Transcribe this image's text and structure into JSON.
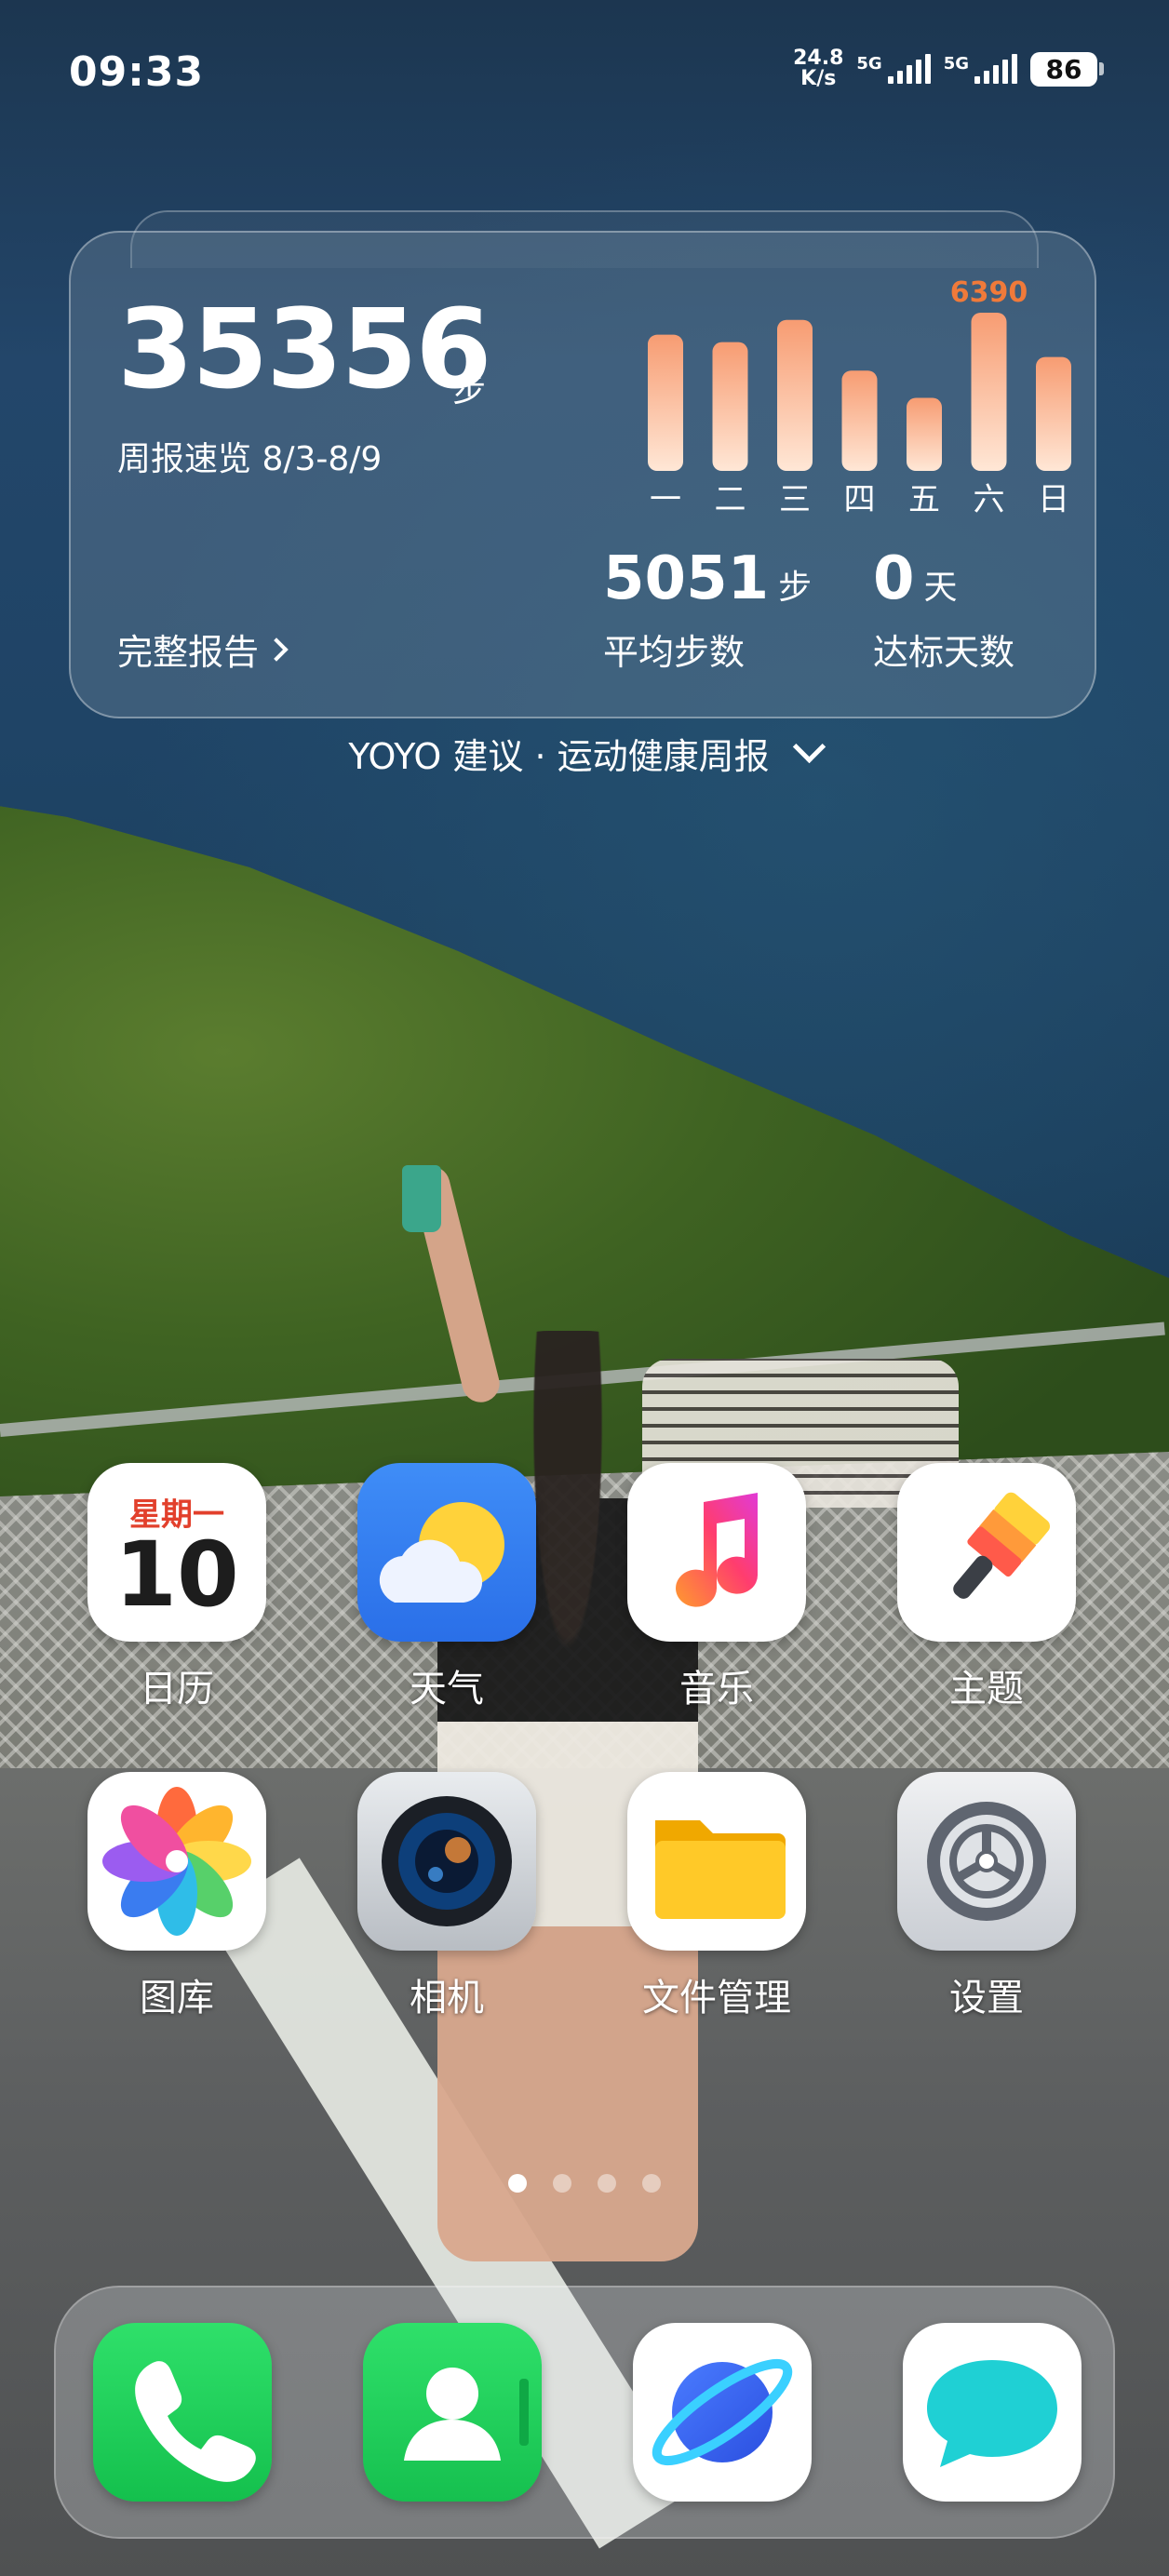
{
  "status": {
    "time": "09:33",
    "net_speed_value": "24.8",
    "net_speed_unit": "K/s",
    "sim1_tag": "5G",
    "sim2_tag": "5G",
    "battery": "86"
  },
  "health_card": {
    "total_steps": "35356",
    "steps_unit": "步",
    "week_title": "周报速览 8/3-8/9",
    "full_report_label": "完整报告",
    "avg_steps": "5051",
    "avg_steps_unit": "步",
    "avg_steps_label": "平均步数",
    "days_on_target": "0",
    "days_unit": "天",
    "days_on_target_label": "达标天数",
    "chart_data": {
      "type": "bar",
      "categories": [
        "一",
        "二",
        "三",
        "四",
        "五",
        "六",
        "日"
      ],
      "values": [
        5500,
        5200,
        6100,
        4050,
        2950,
        6390,
        4600
      ],
      "highlight_label": "6390",
      "highlight_index": 5,
      "ylim": [
        0,
        6390
      ],
      "colors": {
        "top": "#f79c72",
        "bottom": "#ffe7d6",
        "highlight_text": "#f07a3a"
      }
    }
  },
  "suggestion": {
    "text": "YOYO 建议 · 运动健康周报"
  },
  "apps": {
    "calendar": {
      "label": "日历",
      "weekday": "星期一",
      "day": "10"
    },
    "weather": {
      "label": "天气"
    },
    "music": {
      "label": "音乐"
    },
    "theme": {
      "label": "主题"
    },
    "gallery": {
      "label": "图库"
    },
    "camera": {
      "label": "相机"
    },
    "files": {
      "label": "文件管理"
    },
    "settings": {
      "label": "设置"
    }
  },
  "pager": {
    "pages": 4,
    "active": 0
  },
  "dock": [
    "phone-icon",
    "contacts-icon",
    "browser-icon",
    "messages-icon"
  ]
}
